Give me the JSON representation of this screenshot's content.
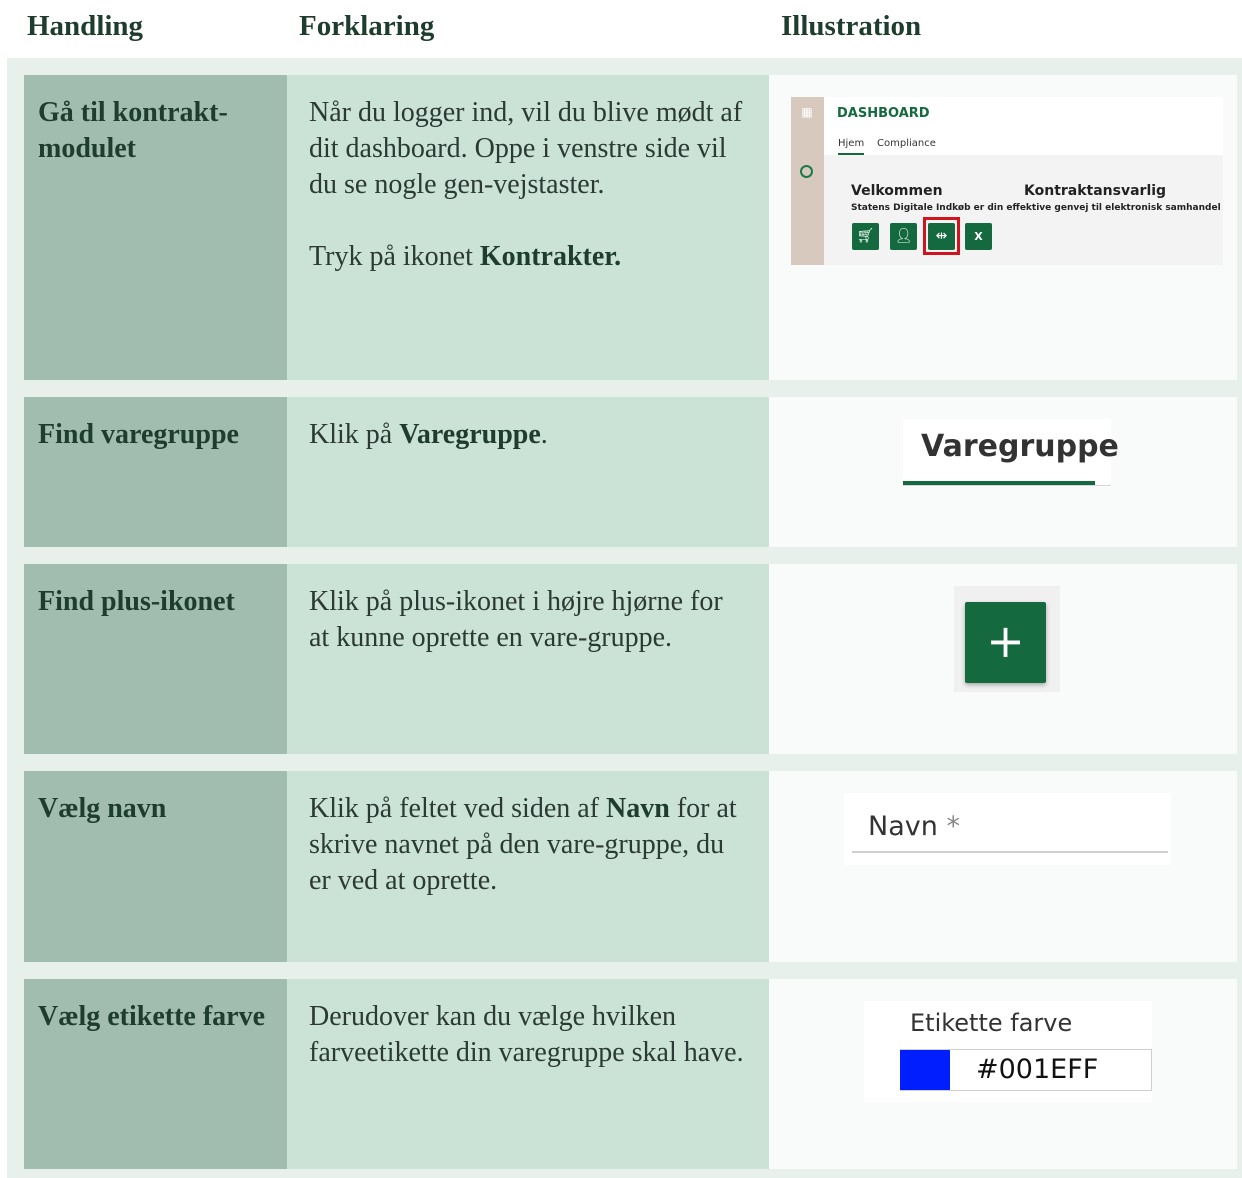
{
  "headers": {
    "action": "Handling",
    "explanation": "Forklaring",
    "illustration": "Illustration"
  },
  "rows": [
    {
      "action": "Gå til kontrakt-modulet",
      "explanation": {
        "para1": "Når du logger ind, vil du blive mødt af dit dashboard. Oppe i venstre side vil du se nogle gen-vejstaster.",
        "para2_prefix": "Tryk på ikonet ",
        "para2_bold": "Kontrakter."
      },
      "illustration": {
        "title": "DASHBOARD",
        "tabs": [
          "Hjem",
          "Compliance"
        ],
        "welcome": "Velkommen",
        "role": "Kontraktansvarlig",
        "subtitle": "Statens Digitale Indkøb er din effektive genvej til elektronisk samhandel",
        "shortcut_icons": [
          "cart-icon",
          "user-icon",
          "contracts-icon",
          "excel-icon"
        ],
        "highlight_color": "#d0141e"
      }
    },
    {
      "action": "Find varegruppe",
      "explanation": {
        "prefix": "Klik på ",
        "bold": "Varegruppe",
        "suffix": "."
      },
      "illustration": {
        "tab_label": "Varegruppe"
      }
    },
    {
      "action": "Find plus-ikonet",
      "explanation": {
        "text": "Klik på plus-ikonet i højre hjørne for at kunne oprette en vare-gruppe."
      },
      "illustration": {
        "button_symbol": "+"
      }
    },
    {
      "action": "Vælg navn",
      "explanation": {
        "prefix": "Klik på feltet ved siden af ",
        "bold": "Navn",
        "suffix": " for at skrive navnet på den vare-gruppe, du er ved at oprette."
      },
      "illustration": {
        "label": "Navn",
        "required": "*"
      }
    },
    {
      "action": "Vælg etikette farve",
      "explanation": {
        "text": "Derudover kan du vælge hvilken farveetikette din varegruppe skal have."
      },
      "illustration": {
        "label": "Etikette farve",
        "value": "#001EFF",
        "swatch": "#001EFF"
      }
    }
  ],
  "colors": {
    "brand_green": "#146a3e",
    "col1_bg": "#a1bdb0",
    "col2_bg": "#cbe2d6"
  }
}
